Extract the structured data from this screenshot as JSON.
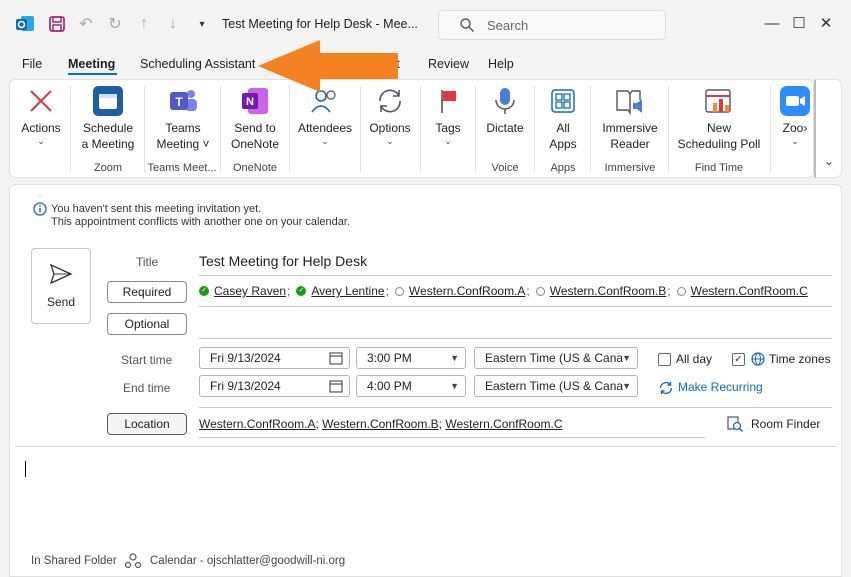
{
  "window": {
    "title": "Test Meeting for Help Desk  -  Mee...",
    "search_placeholder": "Search"
  },
  "menu": {
    "items": [
      "File",
      "Meeting",
      "Scheduling Assistant",
      "xt",
      "Review",
      "Help"
    ],
    "active": "Meeting"
  },
  "annotation": {
    "arrow_color": "#f58220"
  },
  "ribbon": {
    "buttons": {
      "actions": "Actions",
      "schedule_1": "Schedule",
      "schedule_2": "a Meeting",
      "teams_1": "Teams",
      "teams_2": "Meeting",
      "onenote_1": "Send to",
      "onenote_2": "OneNote",
      "attendees": "Attendees",
      "options": "Options",
      "tags": "Tags",
      "dictate": "Dictate",
      "apps_1": "All",
      "apps_2": "Apps",
      "immersive_1": "Immersive",
      "immersive_2": "Reader",
      "poll_1": "New",
      "poll_2": "Scheduling Poll",
      "zoom": "Zoo"
    },
    "groups": {
      "zoom": "Zoom",
      "teams": "Teams Meet...",
      "onenote": "OneNote",
      "voice": "Voice",
      "apps": "Apps",
      "immersive": "Immersive",
      "findtime": "Find Time"
    }
  },
  "info": {
    "line1": "You haven't sent this meeting invitation yet.",
    "line2": "This appointment conflicts with another one on your calendar."
  },
  "form": {
    "send_label": "Send",
    "title_label": "Title",
    "title_value": "Test Meeting for Help Desk",
    "required_label": "Required",
    "optional_label": "Optional",
    "attendees": {
      "a1": "Casey Raven",
      "a2": "Avery Lentine",
      "r1": "Western.ConfRoom.A",
      "r2": "Western.ConfRoom.B",
      "r3": "Western.ConfRoom.C"
    },
    "start_label": "Start time",
    "end_label": "End time",
    "start_date": "Fri 9/13/2024",
    "start_time": "3:00 PM",
    "end_date": "Fri 9/13/2024",
    "end_time": "4:00 PM",
    "timezone": "Eastern Time (US & Cana",
    "all_day_label": "All day",
    "all_day_checked": false,
    "time_zones_label": "Time zones",
    "time_zones_checked": true,
    "make_recurring": "Make Recurring",
    "location_label": "Location",
    "location": {
      "l1": "Western.ConfRoom.A",
      "l2": "Western.ConfRoom.B",
      "l3": "Western.ConfRoom.C"
    },
    "room_finder": "Room Finder"
  },
  "footer": {
    "folder": "In Shared Folder",
    "calendar": "Calendar - ojschlatter@goodwill-ni.org"
  }
}
